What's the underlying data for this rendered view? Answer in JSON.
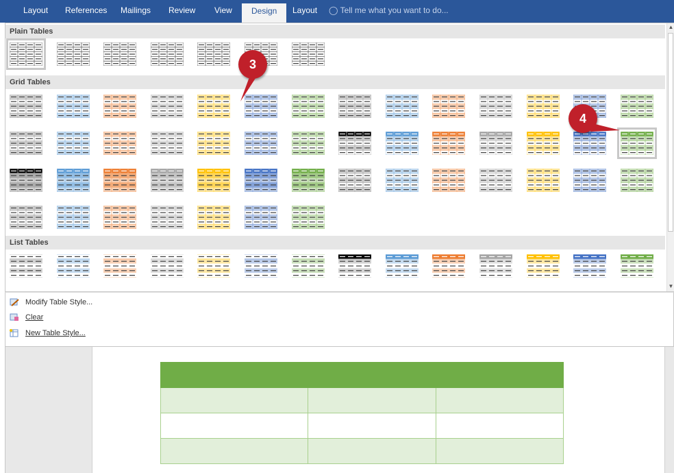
{
  "ribbon": {
    "tabs": [
      "Layout",
      "References",
      "Mailings",
      "Review",
      "View",
      "Design",
      "Layout"
    ],
    "active_tab": "Design",
    "tell_me": "Tell me what you want to do..."
  },
  "gallery": {
    "sections": [
      "Plain Tables",
      "Grid Tables",
      "List Tables"
    ],
    "plain_count": 7,
    "grid_rows": 4,
    "list_rows": 1,
    "colors": [
      "#000000",
      "#5b9bd5",
      "#ed7d31",
      "#a5a5a5",
      "#ffc000",
      "#4472c4",
      "#70ad47"
    ]
  },
  "menu": {
    "modify_icon": "modify-table-style-icon",
    "modify_label": "Modify Table Style...",
    "clear_icon": "clear-icon",
    "clear_label": "Clear",
    "new_icon": "new-table-style-icon",
    "new_label": "New Table Style..."
  },
  "callouts": [
    "3",
    "4"
  ],
  "document_table": {
    "rows": 4,
    "cols": 3,
    "header_color": "#70ad47",
    "band_color": "#e2efda",
    "border_color": "#a8d08d"
  }
}
